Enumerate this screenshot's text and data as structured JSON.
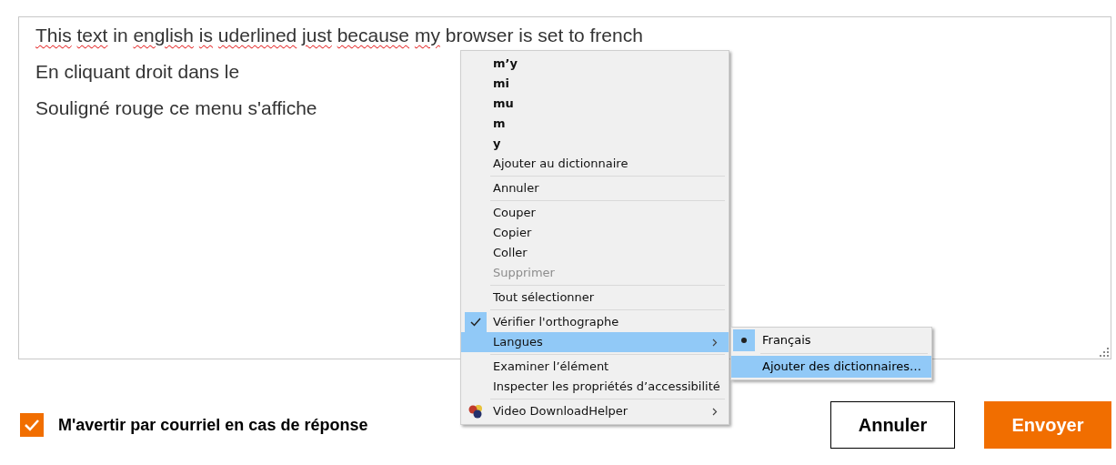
{
  "editor": {
    "lines": [
      {
        "words": [
          {
            "text": "This",
            "misspelled": true
          },
          {
            "text": "text",
            "misspelled": true
          },
          {
            "text": "in",
            "misspelled": false
          },
          {
            "text": "english",
            "misspelled": true
          },
          {
            "text": "is",
            "misspelled": true
          },
          {
            "text": "uderlined",
            "misspelled": true
          },
          {
            "text": "just",
            "misspelled": true
          },
          {
            "text": "because",
            "misspelled": true
          },
          {
            "text": "my",
            "misspelled": true
          },
          {
            "text": "browser",
            "misspelled": false
          },
          {
            "text": "is",
            "misspelled": false
          },
          {
            "text": "set",
            "misspelled": false
          },
          {
            "text": "to",
            "misspelled": false
          },
          {
            "text": "french",
            "misspelled": false
          }
        ]
      },
      {
        "words": [
          {
            "text": "En",
            "misspelled": false
          },
          {
            "text": "cliquant",
            "misspelled": false
          },
          {
            "text": "droit",
            "misspelled": false
          },
          {
            "text": "dans",
            "misspelled": false
          },
          {
            "text": "le",
            "misspelled": false
          }
        ]
      },
      {
        "words": [
          {
            "text": "Souligné",
            "misspelled": false
          },
          {
            "text": "rouge",
            "misspelled": false
          },
          {
            "text": "ce",
            "misspelled": false
          },
          {
            "text": "menu",
            "misspelled": false
          },
          {
            "text": "s'affiche",
            "misspelled": false
          }
        ]
      }
    ]
  },
  "context_menu": {
    "items": [
      {
        "kind": "suggestion",
        "label": "m’y"
      },
      {
        "kind": "suggestion",
        "label": "mi"
      },
      {
        "kind": "suggestion",
        "label": "mu"
      },
      {
        "kind": "suggestion",
        "label": "m"
      },
      {
        "kind": "suggestion",
        "label": "y"
      },
      {
        "kind": "item",
        "label": "Ajouter au dictionnaire",
        "disabled": false,
        "checked": false,
        "selected": false,
        "submenu": false
      },
      {
        "kind": "separator"
      },
      {
        "kind": "item",
        "label": "Annuler",
        "disabled": false,
        "checked": false,
        "selected": false,
        "submenu": false
      },
      {
        "kind": "separator"
      },
      {
        "kind": "item",
        "label": "Couper",
        "disabled": false,
        "checked": false,
        "selected": false,
        "submenu": false
      },
      {
        "kind": "item",
        "label": "Copier",
        "disabled": false,
        "checked": false,
        "selected": false,
        "submenu": false
      },
      {
        "kind": "item",
        "label": "Coller",
        "disabled": false,
        "checked": false,
        "selected": false,
        "submenu": false
      },
      {
        "kind": "item",
        "label": "Supprimer",
        "disabled": true,
        "checked": false,
        "selected": false,
        "submenu": false
      },
      {
        "kind": "separator"
      },
      {
        "kind": "item",
        "label": "Tout sélectionner",
        "disabled": false,
        "checked": false,
        "selected": false,
        "submenu": false
      },
      {
        "kind": "separator"
      },
      {
        "kind": "item",
        "label": "Vérifier l'orthographe",
        "disabled": false,
        "checked": true,
        "selected": false,
        "submenu": false
      },
      {
        "kind": "item",
        "label": "Langues",
        "disabled": false,
        "checked": false,
        "selected": true,
        "submenu": true
      },
      {
        "kind": "separator"
      },
      {
        "kind": "item",
        "label": "Examiner l’élément",
        "disabled": false,
        "checked": false,
        "selected": false,
        "submenu": false
      },
      {
        "kind": "item",
        "label": "Inspecter les propriétés d’accessibilité",
        "disabled": false,
        "checked": false,
        "selected": false,
        "submenu": false
      },
      {
        "kind": "separator"
      },
      {
        "kind": "extension",
        "label": "Video DownloadHelper",
        "disabled": false,
        "checked": false,
        "selected": false,
        "submenu": true
      }
    ]
  },
  "submenu": {
    "items": [
      {
        "kind": "radio",
        "label": "Français",
        "checked": true,
        "selected": false
      },
      {
        "kind": "separator"
      },
      {
        "kind": "item",
        "label": "Ajouter des dictionnaires…",
        "checked": false,
        "selected": true
      }
    ]
  },
  "notify": {
    "label": "M'avertir par courriel en cas de réponse",
    "checked": true
  },
  "buttons": [
    {
      "kind": "secondary",
      "label": "Annuler"
    },
    {
      "kind": "primary",
      "label": "Envoyer"
    }
  ]
}
